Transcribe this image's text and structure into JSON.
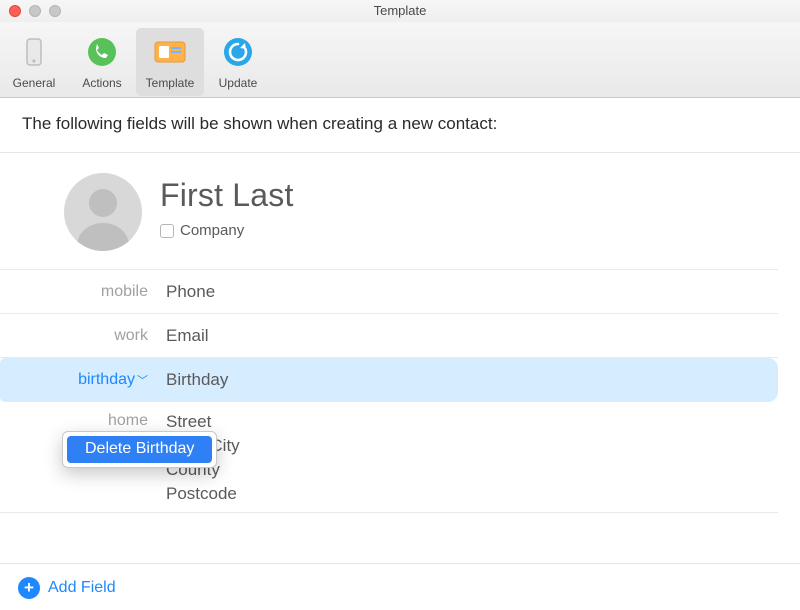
{
  "window": {
    "title": "Template"
  },
  "toolbar": {
    "items": [
      {
        "label": "General",
        "selected": false,
        "icon": "phone-icon"
      },
      {
        "label": "Actions",
        "selected": false,
        "icon": "phone-action-icon"
      },
      {
        "label": "Template",
        "selected": true,
        "icon": "card-icon"
      },
      {
        "label": "Update",
        "selected": false,
        "icon": "refresh-icon"
      }
    ]
  },
  "description": "The following fields will be shown when creating a new contact:",
  "card": {
    "name": "First Last",
    "company_label": "Company",
    "company_checked": false
  },
  "fields": [
    {
      "label": "mobile",
      "value": "Phone",
      "active": false
    },
    {
      "label": "work",
      "value": "Email",
      "active": false
    },
    {
      "label": "birthday",
      "value": "Birthday",
      "active": true
    }
  ],
  "address": {
    "label": "home",
    "lines": [
      "Street",
      "Town/City",
      "County",
      "Postcode"
    ]
  },
  "context_menu": {
    "items": [
      {
        "label": "Delete Birthday"
      }
    ]
  },
  "footer": {
    "add_field_label": "Add Field"
  }
}
